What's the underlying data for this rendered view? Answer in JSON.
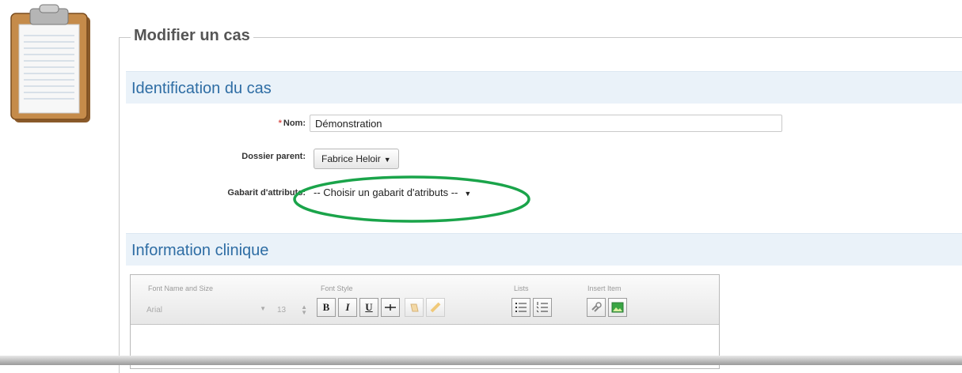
{
  "legend": "Modifier un cas",
  "sections": {
    "identification": "Identification du cas",
    "clinical": "Information clinique"
  },
  "form": {
    "name_label": "Nom:",
    "name_required_mark": "*",
    "name_value": "Démonstration",
    "parent_label": "Dossier parent:",
    "parent_value": "Fabrice Heloir",
    "template_label": "Gabarit d'attributs:",
    "template_value": "-- Choisir un gabarit d'atributs --"
  },
  "editor": {
    "group_font_name": "Font Name and Size",
    "group_font_style": "Font Style",
    "group_lists": "Lists",
    "group_insert": "Insert Item",
    "font_name_value": "Arial",
    "font_size_value": "13",
    "bold_label": "B",
    "italic_label": "I",
    "underline_label": "U"
  },
  "colors": {
    "section_title": "#2e6da4",
    "section_bg": "#eaf2f9",
    "highlight_ellipse": "#1aa44a"
  }
}
